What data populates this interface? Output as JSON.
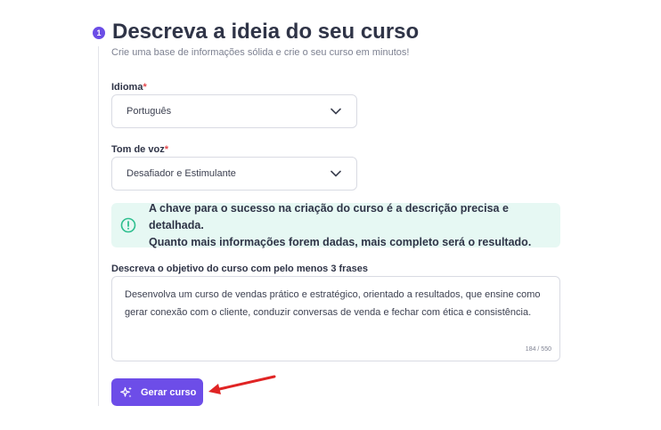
{
  "header": {
    "step_number": "1",
    "title": "Descreva a ideia do seu curso",
    "subtitle": "Crie uma base de informações sólida e crie o seu curso em minutos!"
  },
  "language": {
    "label": "Idioma",
    "required_mark": "*",
    "value": "Português",
    "icon": "chevron-down-icon"
  },
  "tone": {
    "label": "Tom de voz",
    "required_mark": "*",
    "value": "Desafiador e Estimulante",
    "icon": "chevron-down-icon"
  },
  "alert": {
    "icon": "info-circle-icon",
    "line1": "A chave para o sucesso na criação do curso é a descrição precisa e detalhada.",
    "line2": "Quanto mais informações forem dadas, mais completo será o resultado.",
    "background": "#e6f8f3",
    "icon_color": "#2fbf8f"
  },
  "objective": {
    "label": "Descreva o objetivo do curso com pelo menos 3 frases",
    "value": "Desenvolva um curso de vendas prático e estratégico, orientado a resultados, que ensine como gerar conexão com o cliente, conduzir conversas de venda e fechar com ética e consistência.",
    "counter": "184 / 550"
  },
  "generate_button": {
    "label": "Gerar curso",
    "icon": "sparkles-icon",
    "color": "#6d4de8"
  },
  "annotation": {
    "arrow_color": "#e02424",
    "icon": "red-arrow-icon"
  }
}
